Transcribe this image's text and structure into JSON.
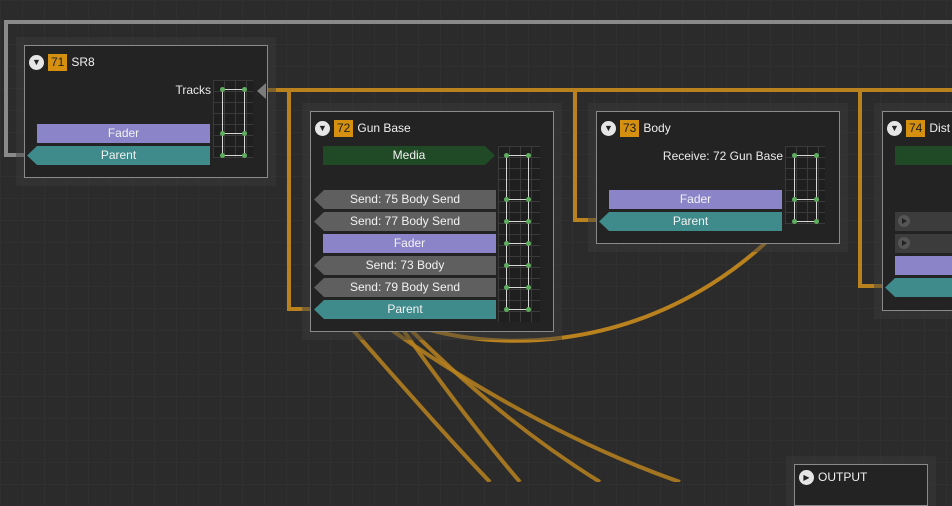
{
  "nodes": {
    "sr8": {
      "number": "71",
      "name": "SR8",
      "tracks_label": "Tracks",
      "fader_label": "Fader",
      "parent_label": "Parent"
    },
    "gun_base": {
      "number": "72",
      "name": "Gun Base",
      "media_label": "Media",
      "sends": [
        "Send: 75 Body Send",
        "Send: 77 Body Send",
        "Fader",
        "Send: 73 Body",
        "Send: 79 Body Send"
      ],
      "parent_label": "Parent"
    },
    "body": {
      "number": "73",
      "name": "Body",
      "receive_label": "Receive: 72 Gun Base",
      "fader_label": "Fader",
      "parent_label": "Parent"
    },
    "dist": {
      "number": "74",
      "name": "Dist"
    },
    "output": {
      "name": "OUTPUT"
    }
  },
  "colors": {
    "wire": "#b9821f",
    "wire_gray": "#8a8a8a",
    "badge": "#d4900e",
    "fader": "#8b84c9",
    "parent": "#3f8a8a",
    "media": "#1f4a25",
    "send": "#5f5f5f"
  }
}
